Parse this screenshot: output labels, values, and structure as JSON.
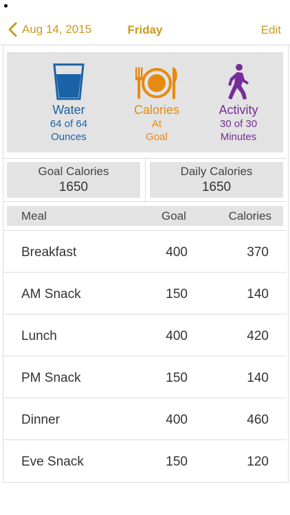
{
  "nav": {
    "back_label": "Aug 14, 2015",
    "title": "Friday",
    "edit_label": "Edit"
  },
  "status": {
    "water": {
      "name": "Water",
      "line1": "64 of 64",
      "line2": "Ounces",
      "color": "#1a63a6",
      "icon": "glass-icon"
    },
    "calories": {
      "name": "Calories",
      "line1": "At",
      "line2": "Goal",
      "color": "#e68a12",
      "icon": "plate-icon"
    },
    "activity": {
      "name": "Activity",
      "line1": "30 of 30",
      "line2": "Minutes",
      "color": "#762d98",
      "icon": "walking-icon"
    }
  },
  "summary": {
    "goal": {
      "label": "Goal Calories",
      "value": "1650"
    },
    "daily": {
      "label": "Daily Calories",
      "value": "1650"
    }
  },
  "table": {
    "headers": {
      "meal": "Meal",
      "goal": "Goal",
      "calories": "Calories"
    },
    "rows": [
      {
        "meal": "Breakfast",
        "goal": "400",
        "calories": "370"
      },
      {
        "meal": "AM Snack",
        "goal": "150",
        "calories": "140"
      },
      {
        "meal": "Lunch",
        "goal": "400",
        "calories": "420"
      },
      {
        "meal": "PM Snack",
        "goal": "150",
        "calories": "140"
      },
      {
        "meal": "Dinner",
        "goal": "400",
        "calories": "460"
      },
      {
        "meal": "Eve Snack",
        "goal": "150",
        "calories": "120"
      }
    ]
  },
  "accent_color": "#c79a1e"
}
